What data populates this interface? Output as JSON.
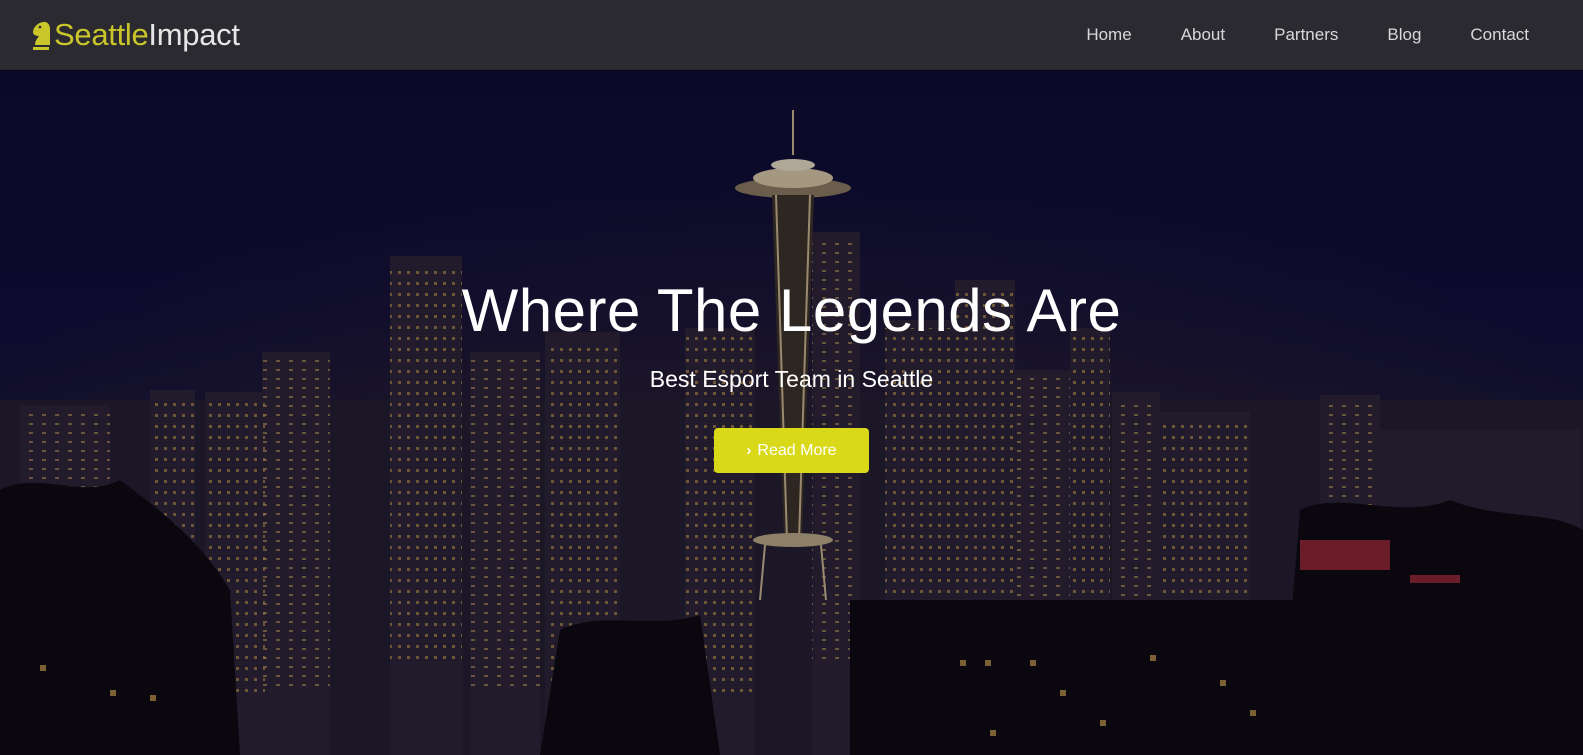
{
  "brand": {
    "first": "Seattle",
    "second": "Impact",
    "icon": "knight-chess-icon",
    "color_first": "#c8c62a",
    "color_second": "#e6e6e6"
  },
  "nav": {
    "items": [
      {
        "label": "Home"
      },
      {
        "label": "About"
      },
      {
        "label": "Partners"
      },
      {
        "label": "Blog"
      },
      {
        "label": "Contact"
      }
    ]
  },
  "hero": {
    "title": "Where The Legends Are",
    "subtitle": "Best Esport Team in Seattle",
    "button_label": "Read More",
    "button_icon": "chevron-right-icon",
    "button_color": "#d9d91a",
    "background": "seattle-skyline-night-photo"
  },
  "colors": {
    "navbar_bg": "#2b2a30",
    "accent": "#d9d91a"
  }
}
